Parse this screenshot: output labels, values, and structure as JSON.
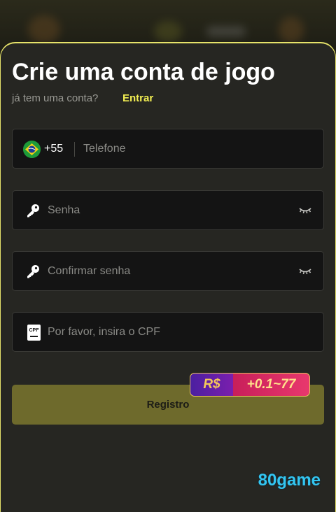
{
  "header": {
    "title": "Crie uma conta de jogo",
    "subtitle": "já tem uma conta?",
    "login_link": "Entrar"
  },
  "form": {
    "phone": {
      "country_code": "+55",
      "placeholder": "Telefone",
      "flag": "brazil-flag-icon"
    },
    "password": {
      "placeholder": "Senha",
      "icon": "key-icon",
      "toggle_icon": "eye-closed-icon"
    },
    "confirm_password": {
      "placeholder": "Confirmar senha",
      "icon": "key-icon",
      "toggle_icon": "eye-closed-icon"
    },
    "cpf": {
      "placeholder": "Por favor, insira o CPF",
      "icon": "cpf-card-icon",
      "icon_text": "CPF"
    },
    "submit_label": "Registro"
  },
  "bonus_badge": {
    "currency": "R$",
    "value": "+0.1~77"
  },
  "brand": {
    "name": "80game"
  },
  "colors": {
    "accent": "#f2ee52",
    "button": "#6e6a2c",
    "brand": "#33c6f2",
    "field_bg": "#141414"
  }
}
